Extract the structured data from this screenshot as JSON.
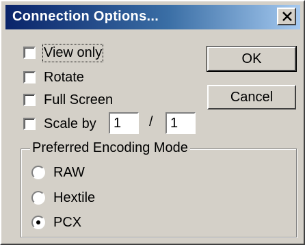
{
  "dialog": {
    "title": "Connection Options...",
    "close_icon": "close-x-icon"
  },
  "options": {
    "view_only": {
      "label": "View only",
      "checked": false
    },
    "rotate": {
      "label": "Rotate",
      "checked": false
    },
    "full_screen": {
      "label": "Full Screen",
      "checked": false
    },
    "scale_by": {
      "label": "Scale by",
      "checked": false,
      "numerator": "1",
      "separator": "/",
      "denominator": "1"
    }
  },
  "buttons": {
    "ok": "OK",
    "cancel": "Cancel"
  },
  "encoding": {
    "group_label": "Preferred Encoding Mode",
    "modes": [
      {
        "label": "RAW",
        "selected": false
      },
      {
        "label": "Hextile",
        "selected": false
      },
      {
        "label": "PCX",
        "selected": true
      }
    ]
  },
  "colors": {
    "face": "#d4d0c8",
    "title_start": "#0a246a",
    "title_end": "#a6caf0"
  }
}
